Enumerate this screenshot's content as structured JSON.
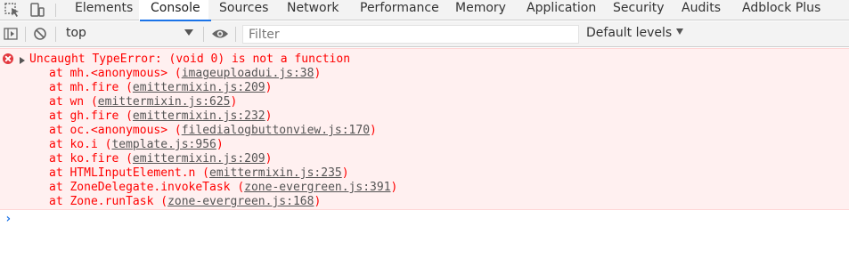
{
  "tabs": [
    {
      "label": "Elements"
    },
    {
      "label": "Console"
    },
    {
      "label": "Sources"
    },
    {
      "label": "Network"
    },
    {
      "label": "Performance"
    },
    {
      "label": "Memory"
    },
    {
      "label": "Application"
    },
    {
      "label": "Security"
    },
    {
      "label": "Audits"
    },
    {
      "label": "Adblock Plus"
    }
  ],
  "active_tab": "Console",
  "toolbar": {
    "context": "top",
    "filter_placeholder": "Filter",
    "filter_value": "",
    "levels": "Default levels"
  },
  "error": {
    "message": "Uncaught TypeError: (void 0) is not a function",
    "frames": [
      {
        "fn": "at mh.<anonymous> (",
        "loc": "imageuploadui.js:38",
        "end": ")"
      },
      {
        "fn": "at mh.fire (",
        "loc": "emittermixin.js:209",
        "end": ")"
      },
      {
        "fn": "at wn (",
        "loc": "emittermixin.js:625",
        "end": ")"
      },
      {
        "fn": "at gh.fire (",
        "loc": "emittermixin.js:232",
        "end": ")"
      },
      {
        "fn": "at oc.<anonymous> (",
        "loc": "filedialogbuttonview.js:170",
        "end": ")"
      },
      {
        "fn": "at ko.i (",
        "loc": "template.js:956",
        "end": ")"
      },
      {
        "fn": "at ko.fire (",
        "loc": "emittermixin.js:209",
        "end": ")"
      },
      {
        "fn": "at HTMLInputElement.n (",
        "loc": "emittermixin.js:235",
        "end": ")"
      },
      {
        "fn": "at ZoneDelegate.invokeTask (",
        "loc": "zone-evergreen.js:391",
        "end": ")"
      },
      {
        "fn": "at Zone.runTask (",
        "loc": "zone-evergreen.js:168",
        "end": ")"
      }
    ]
  },
  "prompt_symbol": "›",
  "colors": {
    "accent": "#1a73e8",
    "error_text": "#ff0000",
    "error_bg": "#fff0f0"
  }
}
